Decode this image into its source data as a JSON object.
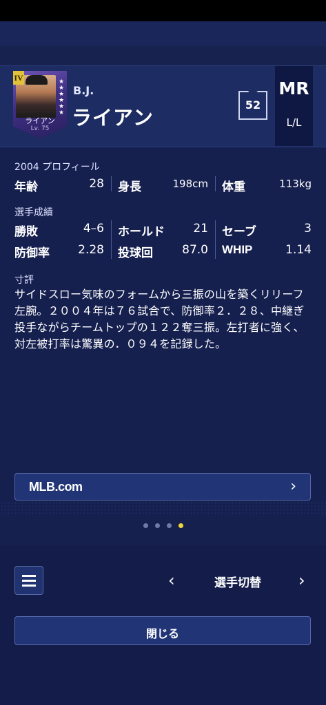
{
  "player": {
    "card_grade": "IV",
    "card_name": "ライアン",
    "card_level": "Lv. 75",
    "name_small": "B.J.",
    "name": "ライアン",
    "number": "52",
    "position": "MR",
    "hand": "L/L"
  },
  "profile": {
    "section_title": "2004 プロフィール",
    "age_label": "年齢",
    "age_value": "28",
    "height_label": "身長",
    "height_value": "198cm",
    "weight_label": "体重",
    "weight_value": "113kg"
  },
  "stats": {
    "section_title": "選手成績",
    "rows": [
      [
        {
          "label": "勝敗",
          "value": "4–6"
        },
        {
          "label": "ホールド",
          "value": "21"
        },
        {
          "label": "セーブ",
          "value": "3"
        }
      ],
      [
        {
          "label": "防御率",
          "value": "2.28"
        },
        {
          "label": "投球回",
          "value": "87.0"
        },
        {
          "label": "WHIP",
          "value": "1.14"
        }
      ]
    ]
  },
  "review": {
    "section_title": "寸評",
    "text": "サイドスロー気味のフォームから三振の山を築くリリーフ左腕。２００４年は７６試合で、防御率２．２８、中継ぎ投手ながらチームトップの１２２奪三振。左打者に強く、対左被打率は驚異の．０９４を記録した。"
  },
  "mlb_link": {
    "label": "MLB.com"
  },
  "pager": {
    "colors": {
      "active": "#f1d43a",
      "inactive": "#6f7aa8"
    }
  },
  "footer": {
    "switch_label": "選手切替",
    "close_label": "閉じる",
    "menu_icon": "hamburger-icon"
  }
}
